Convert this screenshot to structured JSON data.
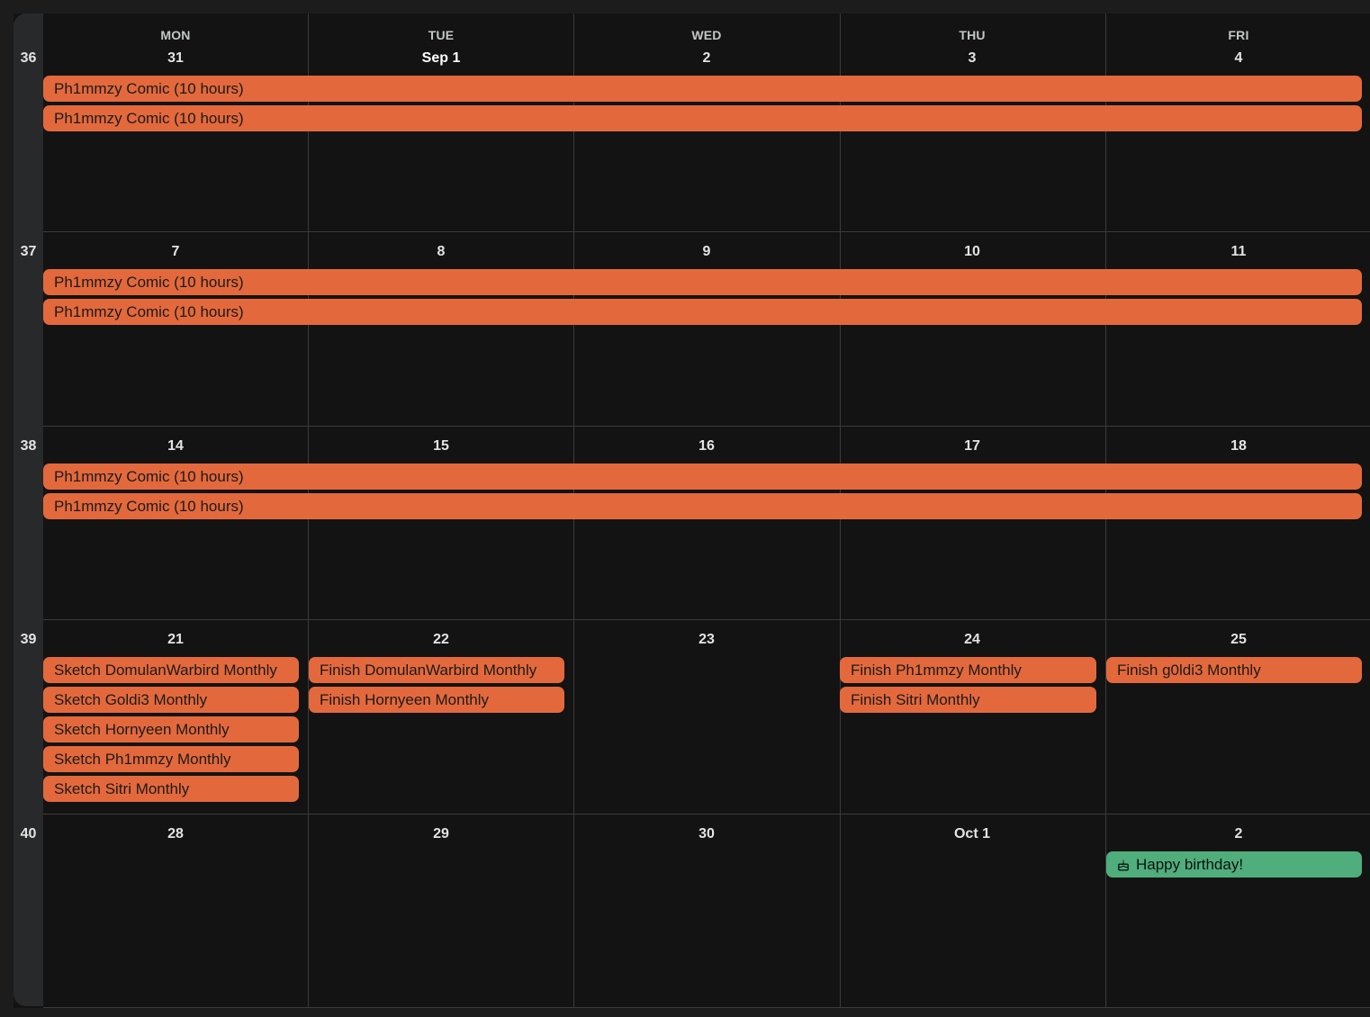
{
  "week_numbers": [
    "36",
    "37",
    "38",
    "39",
    "40"
  ],
  "day_names": [
    "MON",
    "TUE",
    "WED",
    "THU",
    "FRI"
  ],
  "weeks": [
    {
      "dates": [
        "31",
        "Sep 1",
        "2",
        "3",
        "4"
      ]
    },
    {
      "dates": [
        "7",
        "8",
        "9",
        "10",
        "11"
      ]
    },
    {
      "dates": [
        "14",
        "15",
        "16",
        "17",
        "18"
      ]
    },
    {
      "dates": [
        "21",
        "22",
        "23",
        "24",
        "25"
      ]
    },
    {
      "dates": [
        "28",
        "29",
        "30",
        "Oct 1",
        "2"
      ]
    }
  ],
  "events": {
    "recurring_title": "Ph1mmzy Comic (10 hours)",
    "week39_mon": [
      "Sketch DomulanWarbird Monthly",
      "Sketch Goldi3 Monthly",
      "Sketch Hornyeen Monthly",
      "Sketch Ph1mmzy Monthly",
      "Sketch Sitri Monthly"
    ],
    "week39_tue": [
      "Finish DomulanWarbird Monthly",
      "Finish Hornyeen Monthly"
    ],
    "week39_thu": [
      "Finish Ph1mmzy Monthly",
      "Finish Sitri Monthly"
    ],
    "week39_fri": [
      "Finish g0ldi3 Monthly"
    ],
    "week40_fri": "Happy birthday!"
  },
  "colors": {
    "event_orange": "#e3693d",
    "event_green": "#4fae7c",
    "background": "#131314"
  },
  "icons": {
    "birthday": "cake-icon"
  }
}
